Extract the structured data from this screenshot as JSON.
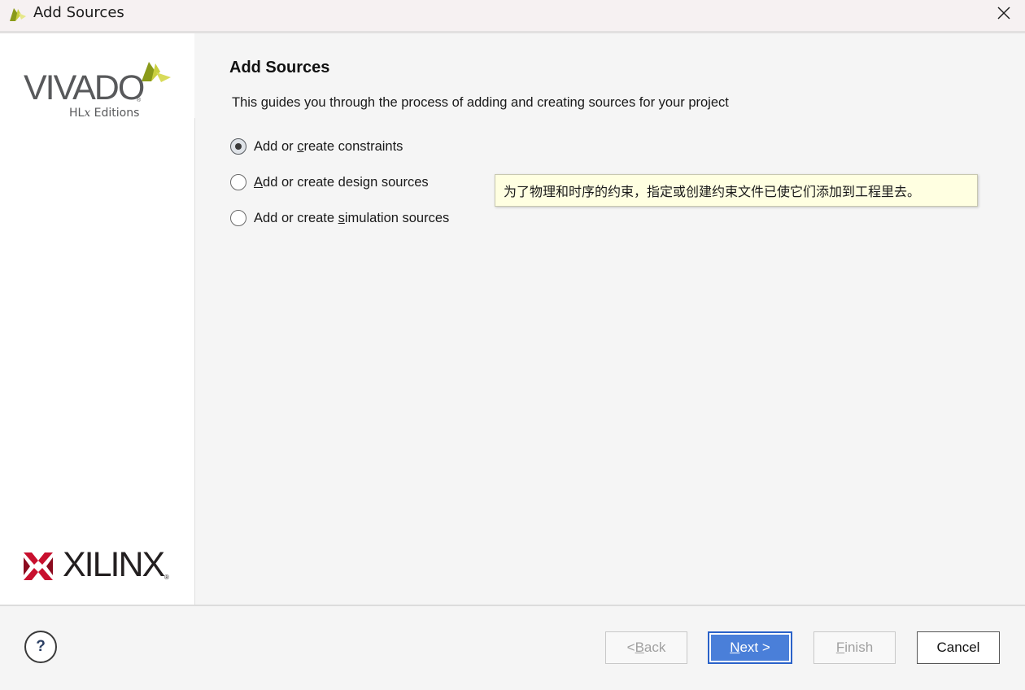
{
  "window": {
    "title": "Add Sources",
    "icons": {
      "app": "vivado-logo-icon",
      "close": "close-icon"
    }
  },
  "sidebar": {
    "vivado_logo": {
      "word": "VIVADO",
      "registered": "®",
      "edition_prefix": "HL",
      "edition_x": "x",
      "edition_suffix": " Editions"
    },
    "xilinx_logo": {
      "word": "XILINX",
      "registered": "®"
    }
  },
  "main": {
    "heading": "Add Sources",
    "description": "This guides you through the process of adding and creating sources for your project",
    "options": [
      {
        "pre": "Add or ",
        "mnemonic": "c",
        "post": "reate constraints",
        "checked": true
      },
      {
        "pre": "",
        "mnemonic": "A",
        "post": "dd or create design sources",
        "checked": false
      },
      {
        "pre": "Add or create ",
        "mnemonic": "s",
        "post": "imulation sources",
        "checked": false
      }
    ],
    "tooltip": "为了物理和时序的约束，指定或创建约束文件已使它们添加到工程里去。"
  },
  "footer": {
    "help_label": "?",
    "back": {
      "pre": "< ",
      "mnemonic": "B",
      "post": "ack",
      "enabled": false
    },
    "next": {
      "pre": "",
      "mnemonic": "N",
      "post": "ext >",
      "enabled": true
    },
    "finish": {
      "pre": "",
      "mnemonic": "F",
      "post": "inish",
      "enabled": false
    },
    "cancel": {
      "label": "Cancel",
      "enabled": true
    }
  },
  "colors": {
    "accent": "#4a7fd9",
    "tooltip_bg": "#ffffe1",
    "xilinx_red": "#c8102e",
    "vivado_green": "#b5c334"
  }
}
